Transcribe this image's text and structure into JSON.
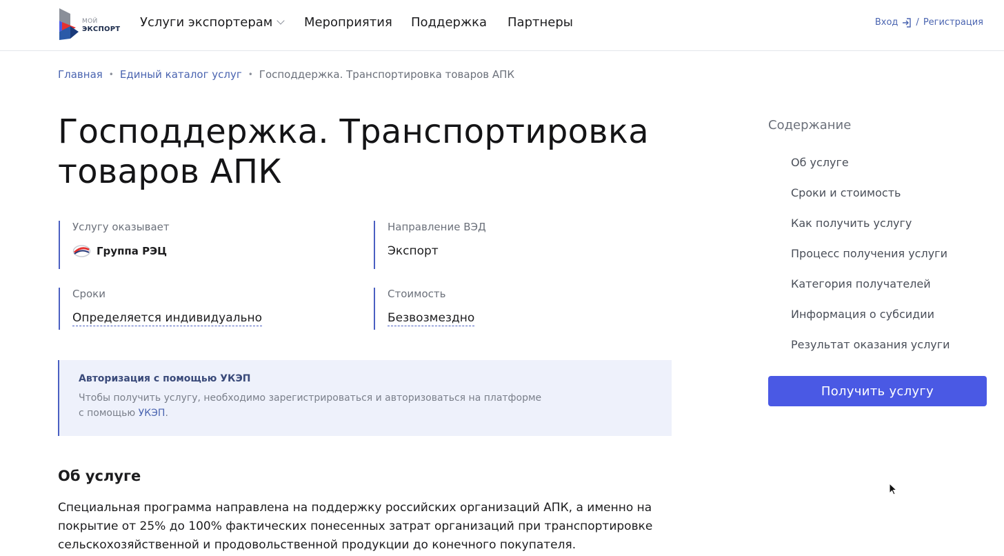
{
  "header": {
    "logo": {
      "line1": "МОЙ",
      "line2": "ЭКСПОРТ"
    },
    "nav": [
      {
        "label": "Услуги экспортерам"
      },
      {
        "label": "Мероприятия"
      },
      {
        "label": "Поддержка"
      },
      {
        "label": "Партнеры"
      }
    ],
    "login": "Вход",
    "separator": "/",
    "register": "Регистрация"
  },
  "breadcrumb": {
    "home": "Главная",
    "catalog": "Единый каталог услуг",
    "current": "Господдержка. Транспортировка товаров АПК",
    "separator": "•"
  },
  "page": {
    "title": "Господдержка. Транспортировка товаров АПК"
  },
  "info": {
    "provider_label": "Услугу оказывает",
    "provider_value": "Группа РЭЦ",
    "direction_label": "Направление ВЭД",
    "direction_value": "Экспорт",
    "terms_label": "Сроки",
    "terms_value": "Определяется индивидуально",
    "cost_label": "Стоимость",
    "cost_value": "Безвозмездно"
  },
  "notice": {
    "title": "Авторизация с помощью УКЭП",
    "text_before": "Чтобы получить услугу, необходимо зарегистрироваться и авторизоваться на платформе с помощью ",
    "link": "УКЭП",
    "text_after": "."
  },
  "about": {
    "title": "Об услуге",
    "text": "Специальная программа направлена на поддержку российских организаций АПК, а именно на покрытие от 25% до 100% фактических понесенных затрат организаций при транспортировке сельскохозяйственной и продовольственной продукции до конечного покупателя."
  },
  "toc": {
    "title": "Содержание",
    "items": [
      "Об услуге",
      "Сроки и стоимость",
      "Как получить услугу",
      "Процесс получения услуги",
      "Категория получателей",
      "Информация о субсидии",
      "Результат оказания услуги"
    ],
    "cta": "Получить услугу"
  },
  "colors": {
    "accent": "#4a59e4",
    "link": "#4a64b0",
    "border_accent": "#4a5fc1",
    "notice_bg": "#eef1fb"
  }
}
